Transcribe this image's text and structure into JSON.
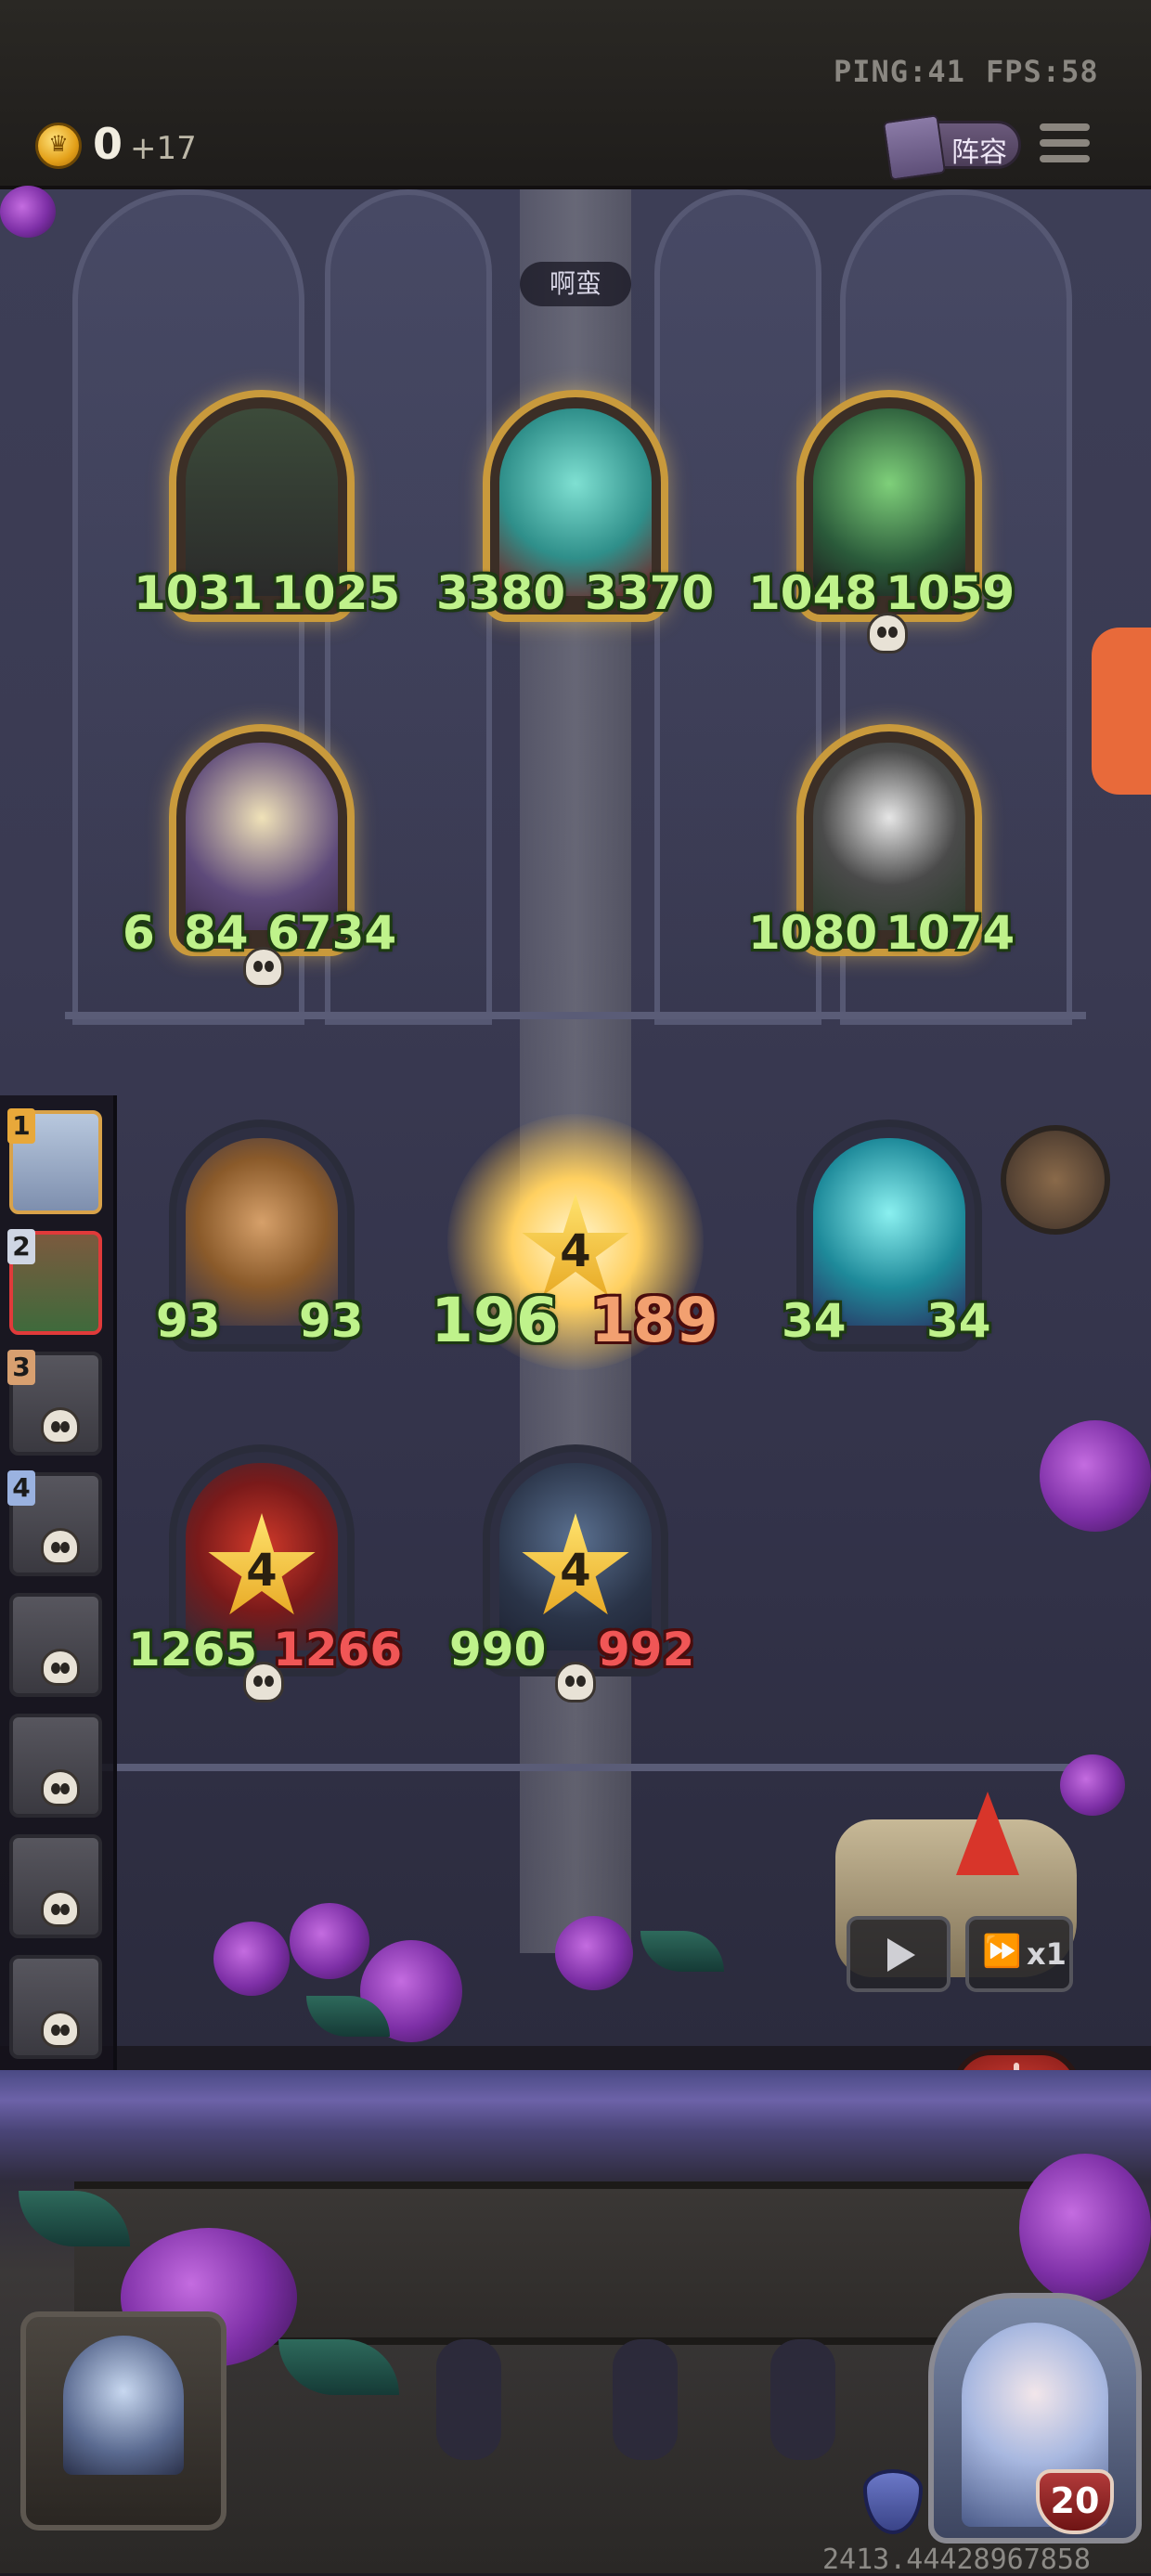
{
  "hud": {
    "ping": "PING:41",
    "fps": "FPS:58",
    "gold": "0",
    "gold_income": "+17",
    "lineup_label": "阵容"
  },
  "opponent_name": "啊蛮",
  "enemy_units": [
    {
      "attack": "1031",
      "health": "1025"
    },
    {
      "attack": "3380",
      "health": "3370"
    },
    {
      "attack": "1048",
      "health": "1059"
    },
    {
      "attack": "6",
      "attack_rest": "84",
      "health": "6734"
    },
    {
      "attack": "1080",
      "health": "1074"
    }
  ],
  "ally_units": [
    {
      "attack": "93",
      "health": "93"
    },
    {
      "attack": "196",
      "health": "189",
      "star": "4"
    },
    {
      "attack": "34",
      "health": "34"
    },
    {
      "attack": "1265",
      "health": "1266",
      "star": "4"
    },
    {
      "attack": "990",
      "health": "992",
      "star": "4"
    }
  ],
  "roster": [
    "1",
    "2",
    "3",
    "4"
  ],
  "speed_label": "x1",
  "player_level": "20",
  "bottom_readout": "2413.44428967858",
  "colors": {
    "stat_green": "#bff28b",
    "stat_red": "#f05656",
    "gold_frame": "#c99a3c"
  }
}
